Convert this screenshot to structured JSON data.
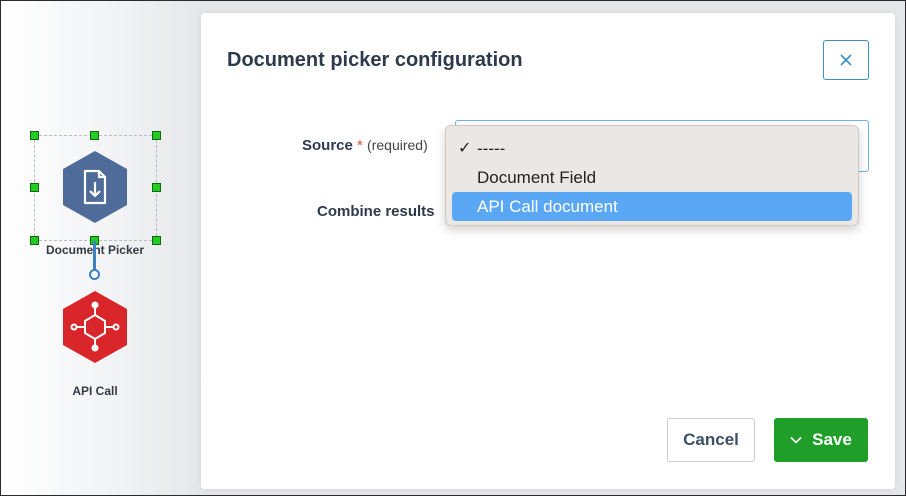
{
  "dialog": {
    "title": "Document picker configuration",
    "close_icon": "close-icon"
  },
  "fields": {
    "source": {
      "label": "Source",
      "required_marker": "*",
      "required_text": "(required)"
    },
    "combine": {
      "label": "Combine results"
    }
  },
  "dropdown": {
    "options": [
      {
        "label": "-----",
        "checked": true,
        "highlighted": false
      },
      {
        "label": "Document Field",
        "checked": false,
        "highlighted": false
      },
      {
        "label": "API Call document",
        "checked": false,
        "highlighted": true
      }
    ],
    "check_glyph": "✓"
  },
  "canvas": {
    "nodes": [
      {
        "label": "Document Picker",
        "icon": "document-picker-icon",
        "color": "#4f6b9a"
      },
      {
        "label": "API Call",
        "icon": "api-call-icon",
        "color": "#d9262b"
      }
    ]
  },
  "buttons": {
    "cancel": "Cancel",
    "save": "Save",
    "save_icon": "chevron-down-icon"
  },
  "colors": {
    "accent": "#3a8fc7",
    "save_green": "#1f9e2a",
    "highlight": "#5aa7f5",
    "handle_green": "#22cc22"
  }
}
